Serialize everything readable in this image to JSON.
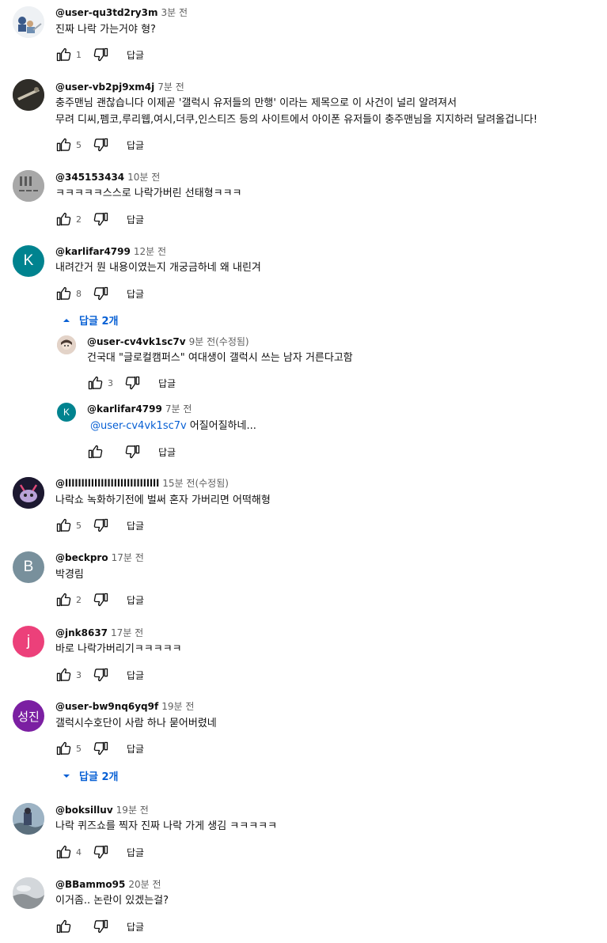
{
  "labels": {
    "reply": "답글"
  },
  "comments": [
    {
      "author": "@user-qu3td2ry3m",
      "time": "3분 전",
      "text": "진짜 나락 가는거야 형?",
      "likes": "1"
    },
    {
      "author": "@user-vb2pj9xm4j",
      "time": "7분 전",
      "text": "충주맨님 괜찮습니다 이제곧 '갤럭시 유저들의 만행' 이라는 제목으로 이 사건이 널리 알려져서",
      "text2": "무려 디씨,펨코,루리웹,여시,더쿠,인스티즈 등의 사이트에서 아이폰 유저들이 충주맨님을 지지하러 달려올겁니다!",
      "likes": "5"
    },
    {
      "author": "@345153434",
      "time": "10분 전",
      "text": "ㅋㅋㅋㅋㅋ스스로 나락가버린 선태형ㅋㅋㅋ",
      "likes": "2"
    },
    {
      "author": "@karlifar4799",
      "time": "12분 전",
      "text": "내려간거 뭔 내용이였는지 개궁금하네 왜 내린겨",
      "likes": "8",
      "avatar_letter": "K",
      "avatar_color": "#00838f"
    },
    {
      "author": "@lllllllllllllllllllllllllllll",
      "time": "15분 전(수정됨)",
      "text": "나락쇼 녹화하기전에 벌써 혼자 가버리면 어떡해형",
      "likes": "5"
    },
    {
      "author": "@beckpro",
      "time": "17분 전",
      "text": "박경림",
      "likes": "2",
      "avatar_letter": "B",
      "avatar_color": "#78909c"
    },
    {
      "author": "@jnk8637",
      "time": "17분 전",
      "text": "바로 나락가버리기ㅋㅋㅋㅋㅋ",
      "likes": "3",
      "avatar_letter": "j",
      "avatar_color": "#ec407a"
    },
    {
      "author": "@user-bw9nq6yq9f",
      "time": "19분 전",
      "text": "갤럭시수호단이 사람 하나 묻어버렸네",
      "likes": "5",
      "avatar_letter": "성진",
      "avatar_color": "#7b1fa2"
    },
    {
      "author": "@boksilluv",
      "time": "19분 전",
      "text": "나락 퀴즈쇼를 찍자 진짜 나락 가게 생김 ㅋㅋㅋㅋㅋ",
      "likes": "4"
    },
    {
      "author": "@BBammo95",
      "time": "20분 전",
      "text": "이거좀.. 논란이 있겠는걸?",
      "likes": ""
    }
  ],
  "replies": [
    {
      "author": "@user-cv4vk1sc7v",
      "time": "9분 전(수정됨)",
      "text": "건국대 \"글로컬캠퍼스\" 여대생이 갤럭시 쓰는 남자 거른다고함",
      "likes": "3"
    },
    {
      "author": "@karlifar4799",
      "time": "7분 전",
      "mention": "@user-cv4vk1sc7v",
      "text": "어질어질하네...",
      "likes": "",
      "avatar_letter": "K",
      "avatar_color": "#00838f"
    }
  ],
  "toggles": [
    {
      "label": "답글 2개",
      "state": "expanded"
    },
    {
      "label": "답글 2개",
      "state": "collapsed"
    }
  ],
  "icons": [
    "thumb-up-icon",
    "thumb-down-icon",
    "chevron-up-icon",
    "chevron-down-icon"
  ],
  "colors": {
    "link": "#065fd4",
    "secondary_text": "#606060"
  }
}
